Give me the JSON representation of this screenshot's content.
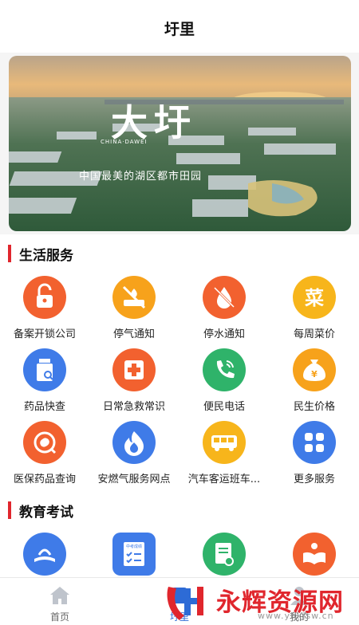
{
  "header": {
    "title": "圩里"
  },
  "banner": {
    "calligraphy": "大圩",
    "english": "CHINA·DAWEI",
    "slogan": "中国最美的湖区都市田园"
  },
  "life_services": {
    "title": "生活服务",
    "items": [
      {
        "label": "备案开锁公司",
        "icon": "unlock-icon",
        "color": "#f2612f"
      },
      {
        "label": "停气通知",
        "icon": "gas-off-icon",
        "color": "#f7a21b"
      },
      {
        "label": "停水通知",
        "icon": "water-off-icon",
        "color": "#f2612f"
      },
      {
        "label": "每周菜价",
        "icon": "vegetable-price-icon",
        "color": "#f7b51b"
      },
      {
        "label": "药品快查",
        "icon": "medicine-bottle-icon",
        "color": "#3f7be8"
      },
      {
        "label": "日常急救常识",
        "icon": "first-aid-icon",
        "color": "#f2612f"
      },
      {
        "label": "便民电话",
        "icon": "phone-icon",
        "color": "#2fb36a"
      },
      {
        "label": "民生价格",
        "icon": "money-bag-icon",
        "color": "#f7a21b"
      },
      {
        "label": "医保药品查询",
        "icon": "pill-icon",
        "color": "#f2612f"
      },
      {
        "label": "安燃气服务网点",
        "icon": "flame-icon",
        "color": "#3f7be8"
      },
      {
        "label": "汽车客运班车...",
        "icon": "bus-icon",
        "color": "#f7b51b"
      },
      {
        "label": "更多服务",
        "icon": "more-grid-icon",
        "color": "#3f7be8"
      }
    ]
  },
  "education": {
    "title": "教育考试",
    "items": [
      {
        "icon": "school-book-icon",
        "color": "#3f7be8"
      },
      {
        "icon": "exam-checklist-icon",
        "color": "#3f7be8",
        "caption": "中考成绩"
      },
      {
        "icon": "document-search-icon",
        "color": "#2fb36a"
      },
      {
        "icon": "reading-book-icon",
        "color": "#f2612f"
      }
    ]
  },
  "tabbar": {
    "tabs": [
      {
        "label": "首页"
      },
      {
        "label": "圩里"
      },
      {
        "label": "我的"
      }
    ]
  },
  "watermark": {
    "text": "永辉资源网",
    "url": "www.yhkjsw.cn"
  }
}
